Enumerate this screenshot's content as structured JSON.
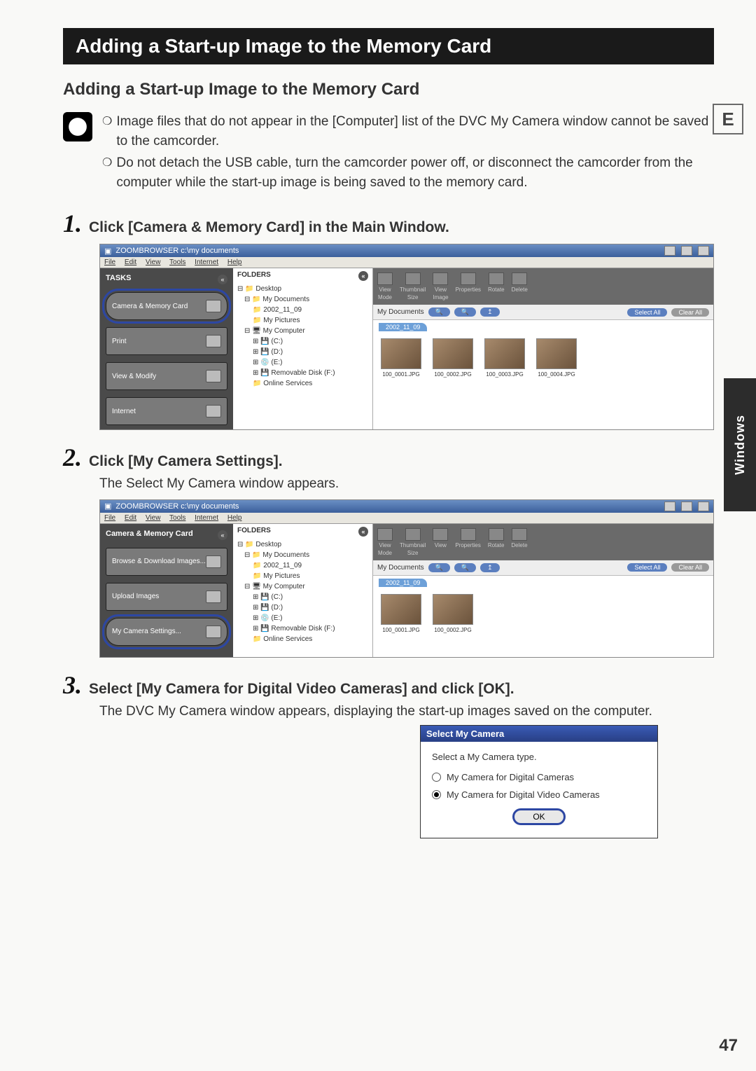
{
  "header_bar": "Adding a Start-up Image to the Memory Card",
  "subheading": "Adding a Start-up Image to the Memory Card",
  "side_letter": "E",
  "side_tab": "Windows",
  "page_number": "47",
  "notes": [
    "Image files that do not appear in the [Computer] list of the DVC My Camera window cannot be saved to the camcorder.",
    "Do not detach the USB cable, turn the camcorder power off, or disconnect the camcorder from the computer while the start-up image is being saved to the memory card."
  ],
  "steps": {
    "s1": {
      "num": "1.",
      "title": "Click [Camera & Memory Card] in the Main Window."
    },
    "s2": {
      "num": "2.",
      "title": "Click [My Camera Settings].",
      "desc": "The Select My Camera window appears."
    },
    "s3": {
      "num": "3.",
      "title": "Select [My Camera for Digital Video Cameras] and click [OK].",
      "desc": "The DVC My Camera window appears, displaying the start-up images saved on the computer."
    }
  },
  "screenshot_common": {
    "win_title": "ZOOMBROWSER c:\\my documents",
    "menus": [
      "File",
      "Edit",
      "View",
      "Tools",
      "Internet",
      "Help"
    ],
    "folders_header": "FOLDERS",
    "tree": {
      "root": "Desktop",
      "l1": "My Documents",
      "l2a": "2002_11_09",
      "l2b": "My Pictures",
      "comp": "My Computer",
      "c": "(C:)",
      "d": "(D:)",
      "e": "(E:)",
      "f": "Removable Disk (F:)",
      "online": "Online Services"
    },
    "toolbar": {
      "view": "View",
      "thumb": "Thumbnail",
      "viewimg": "View",
      "props": "Properties",
      "rotate": "Rotate",
      "delete": "Delete",
      "mode": "Mode",
      "size": "Size",
      "image": "Image"
    },
    "path_label": "My Documents",
    "select_all": "Select All",
    "clear_all": "Clear All",
    "date_tab": "2002_11_09",
    "thumbs": [
      "100_0001.JPG",
      "100_0002.JPG",
      "100_0003.JPG",
      "100_0004.JPG"
    ]
  },
  "ss1": {
    "left_title": "TASKS",
    "buttons": {
      "cam": "Camera & Memory Card",
      "print": "Print",
      "view": "View & Modify",
      "internet": "Internet"
    }
  },
  "ss2": {
    "left_title": "Camera & Memory Card",
    "buttons": {
      "browse": "Browse & Download Images...",
      "upload": "Upload Images",
      "settings": "My Camera Settings..."
    }
  },
  "dialog": {
    "title": "Select My Camera",
    "label": "Select a My Camera type.",
    "opt1": "My Camera for Digital Cameras",
    "opt2": "My Camera for Digital Video Cameras",
    "ok": "OK"
  }
}
